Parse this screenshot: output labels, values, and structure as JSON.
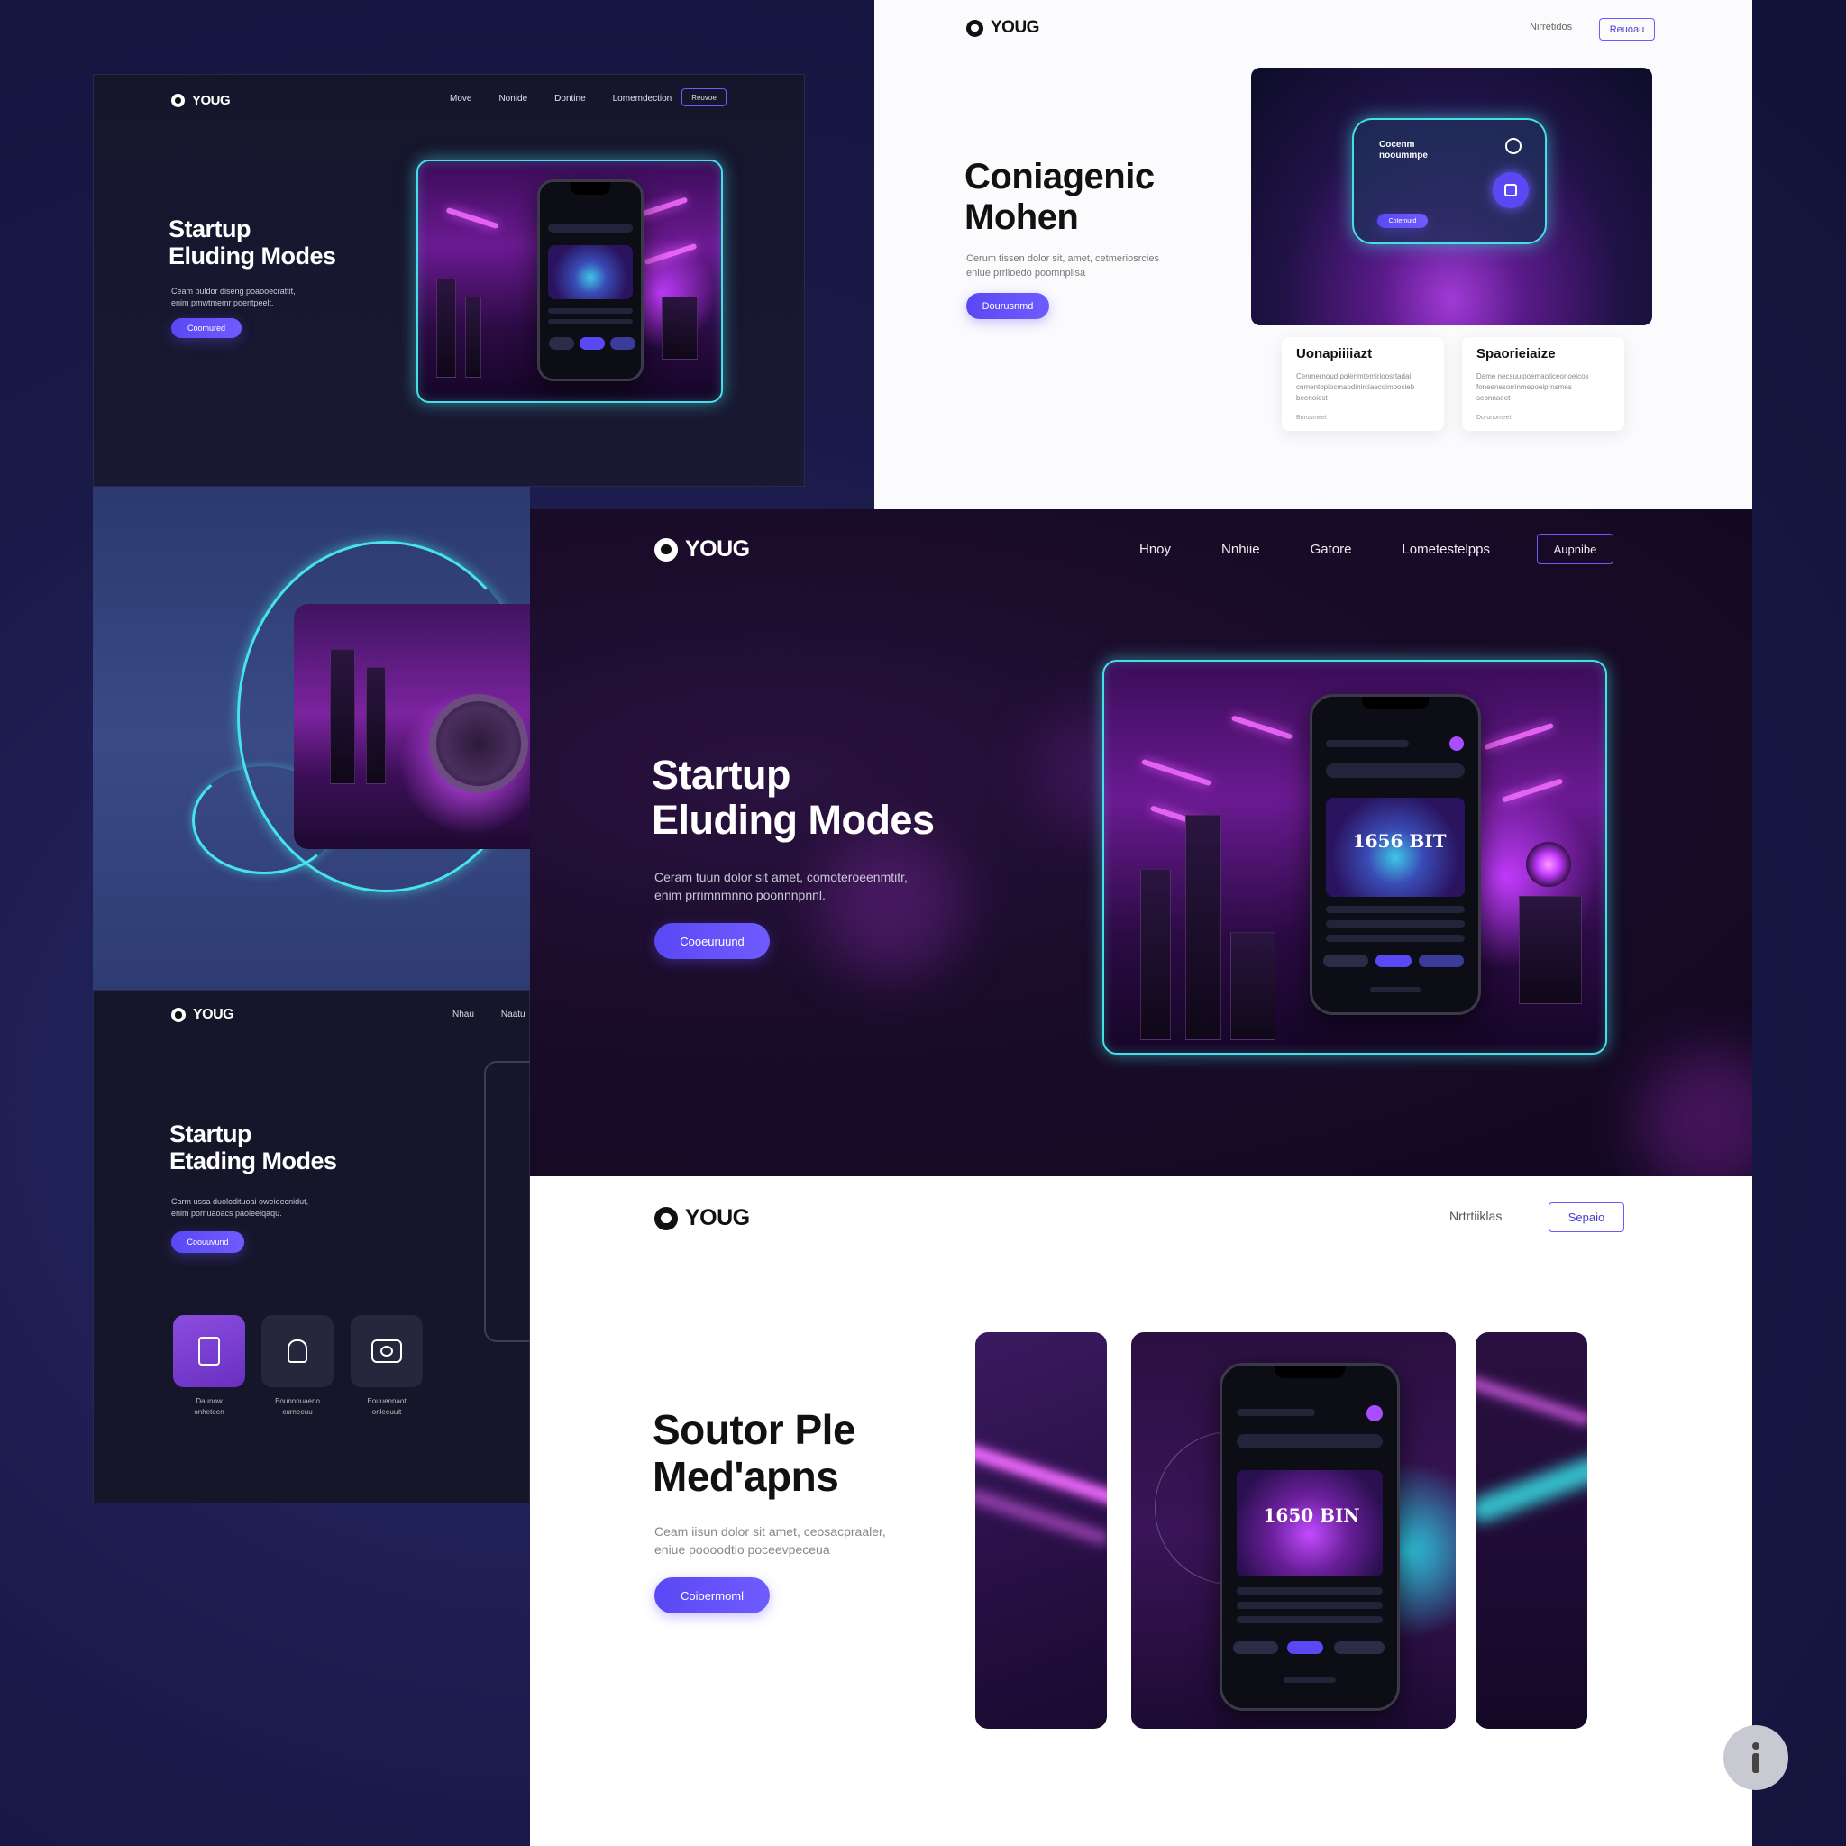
{
  "brand": "YOUG",
  "panel_top_left": {
    "nav": [
      "Move",
      "Nonide",
      "Dontine",
      "Lomemdection"
    ],
    "cta": "Reuvoe",
    "title_line1": "Startup",
    "title_line2": "Eluding Modes",
    "sub_line1": "Ceam buldor diseng poaooecrattit,",
    "sub_line2": "enim pmwtmemr poentpeelt.",
    "button": "Coomured"
  },
  "panel_top_right": {
    "nav": [
      "Nirretidos"
    ],
    "cta": "Reuoau",
    "title_line1": "Coniagenic",
    "title_line2": "Mohen",
    "sub_line1": "Cerum tissen dolor sit, amet, cetmeriosrcies",
    "sub_line2": "eniue prriioedo poomnpiisa",
    "button": "Dourusnmd",
    "card_text": "Cocenm",
    "card_text2": "nooummpe",
    "card_btn": "Cotemurd",
    "feature_cards": [
      {
        "title": "Uonapiiiiazt",
        "desc1": "Cenmernoud polenmtemirioosrtadai",
        "desc2": "cnmentopiocmaodinirciaecqimoocieb",
        "desc3": "beenoiest",
        "meta": "Borusmeet"
      },
      {
        "title": "Spaorieiaize",
        "desc1": "Dame necsuuipoemaoticeonoeicos",
        "desc2": "foneenesorrinmepoeiprnsmes",
        "desc3": "seonnaeet",
        "meta": "Dorunomeet"
      }
    ]
  },
  "panel_main": {
    "nav": [
      "Hnoy",
      "Nnhiie",
      "Gatore",
      "Lometestelpps"
    ],
    "cta": "Aupnibe",
    "title_line1": "Startup",
    "title_line2": "Eluding Modes",
    "sub_line1": "Ceram tuun dolor sit amet, comoteroeenmtitr,",
    "sub_line2": "enim prrimnmnno poonnnpnnl.",
    "button": "Cooeuruund",
    "phone_art_text": "1656 BIT"
  },
  "panel_bottom_left": {
    "nav": [
      "Nhau",
      "Naatu"
    ],
    "title_line1": "Startup",
    "title_line2": "Etading Modes",
    "sub_line1": "Carm ussa duolodituoai oweieecnidut,",
    "sub_line2": "enim pomuaoacs paoleeiqaqu.",
    "button": "Coouuvund",
    "tiles": [
      {
        "icon": "document-icon",
        "label1": "Daunow",
        "label2": "onheteen"
      },
      {
        "icon": "lock-icon",
        "label1": "Eounnnuaeno",
        "label2": "curneeuu"
      },
      {
        "icon": "camera-icon",
        "label1": "Eouuennaot",
        "label2": "onleeuuit"
      }
    ]
  },
  "panel_bottom": {
    "nav": [
      "Nrtrtiiklas"
    ],
    "cta": "Sepaio",
    "title_line1": "Soutor Ple",
    "title_line2": "Med'apns",
    "sub_line1": "Ceam iisun dolor sit amet, ceosacpraaler,",
    "sub_line2": "eniue poooodtio poceevpeceua",
    "button": "Coioermoml",
    "phone_art_text": "1650 BIN"
  },
  "colors": {
    "accent": "#5a48f5",
    "neon_cyan": "#45e0e6",
    "neon_magenta": "#e255ff",
    "background": "#1a1a4a"
  }
}
